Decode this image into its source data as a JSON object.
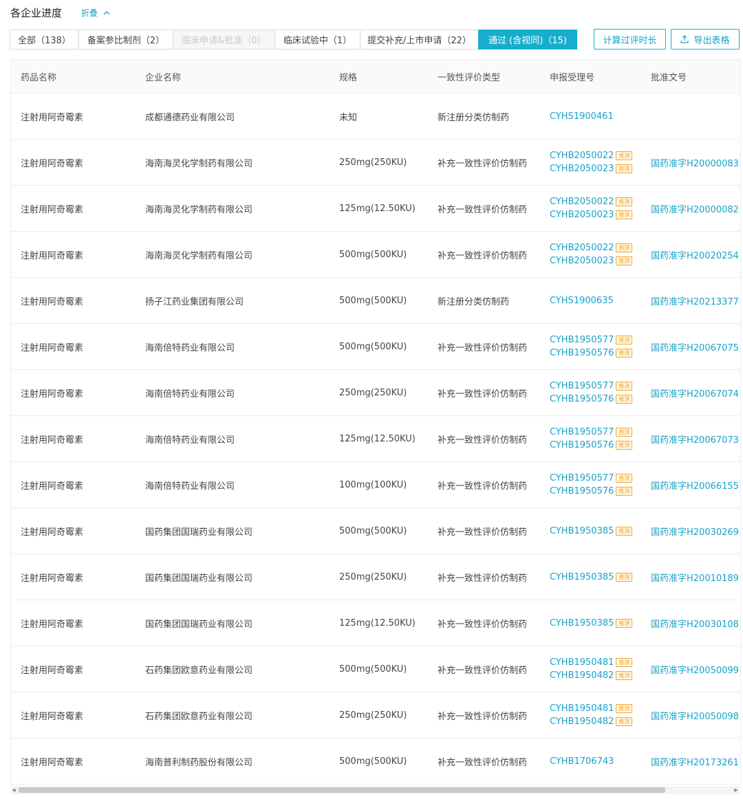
{
  "header": {
    "title": "各企业进度",
    "fold_label": "折叠",
    "fold_icon": "chevron-up"
  },
  "tabs": [
    {
      "label": "全部（138）",
      "state": "normal"
    },
    {
      "label": "备案参比制剂（2）",
      "state": "normal"
    },
    {
      "label": "临床申请&批准（0）",
      "state": "disabled"
    },
    {
      "label": "临床试验中（1）",
      "state": "normal"
    },
    {
      "label": "提交补充/上市申请（22）",
      "state": "normal"
    },
    {
      "label": "通过 (含视同)（15)",
      "state": "active"
    }
  ],
  "actions": {
    "calc_label": "计算过评时长",
    "export_label": "导出表格"
  },
  "colors": {
    "accent": "#17aece",
    "badge": "#f5a623"
  },
  "table": {
    "columns": [
      "药品名称",
      "企业名称",
      "规格",
      "一致性评价类型",
      "申报受理号",
      "批准文号"
    ],
    "badge_label": "推测",
    "rows": [
      {
        "drug": "注射用阿奇霉素",
        "company": "成都通德药业有限公司",
        "spec": "未知",
        "type": "新注册分类仿制药",
        "accept": [
          "CYHS1900461"
        ],
        "badge": [
          false
        ],
        "approval": ""
      },
      {
        "drug": "注射用阿奇霉素",
        "company": "海南海灵化学制药有限公司",
        "spec": "250mg(250KU)",
        "type": "补充一致性评价仿制药",
        "accept": [
          "CYHB2050022",
          "CYHB2050023"
        ],
        "badge": [
          true,
          true
        ],
        "approval": "国药准字H20000083"
      },
      {
        "drug": "注射用阿奇霉素",
        "company": "海南海灵化学制药有限公司",
        "spec": "125mg(12.50KU)",
        "type": "补充一致性评价仿制药",
        "accept": [
          "CYHB2050022",
          "CYHB2050023"
        ],
        "badge": [
          true,
          true
        ],
        "approval": "国药准字H20000082"
      },
      {
        "drug": "注射用阿奇霉素",
        "company": "海南海灵化学制药有限公司",
        "spec": "500mg(500KU)",
        "type": "补充一致性评价仿制药",
        "accept": [
          "CYHB2050022",
          "CYHB2050023"
        ],
        "badge": [
          true,
          true
        ],
        "approval": "国药准字H20020254"
      },
      {
        "drug": "注射用阿奇霉素",
        "company": "扬子江药业集团有限公司",
        "spec": "500mg(500KU)",
        "type": "新注册分类仿制药",
        "accept": [
          "CYHS1900635"
        ],
        "badge": [
          false
        ],
        "approval": "国药准字H20213377"
      },
      {
        "drug": "注射用阿奇霉素",
        "company": "海南倍特药业有限公司",
        "spec": "500mg(500KU)",
        "type": "补充一致性评价仿制药",
        "accept": [
          "CYHB1950577",
          "CYHB1950576"
        ],
        "badge": [
          true,
          true
        ],
        "approval": "国药准字H20067075"
      },
      {
        "drug": "注射用阿奇霉素",
        "company": "海南倍特药业有限公司",
        "spec": "250mg(250KU)",
        "type": "补充一致性评价仿制药",
        "accept": [
          "CYHB1950577",
          "CYHB1950576"
        ],
        "badge": [
          true,
          true
        ],
        "approval": "国药准字H20067074"
      },
      {
        "drug": "注射用阿奇霉素",
        "company": "海南倍特药业有限公司",
        "spec": "125mg(12.50KU)",
        "type": "补充一致性评价仿制药",
        "accept": [
          "CYHB1950577",
          "CYHB1950576"
        ],
        "badge": [
          true,
          true
        ],
        "approval": "国药准字H20067073"
      },
      {
        "drug": "注射用阿奇霉素",
        "company": "海南倍特药业有限公司",
        "spec": "100mg(100KU)",
        "type": "补充一致性评价仿制药",
        "accept": [
          "CYHB1950577",
          "CYHB1950576"
        ],
        "badge": [
          true,
          true
        ],
        "approval": "国药准字H20066155"
      },
      {
        "drug": "注射用阿奇霉素",
        "company": "国药集团国瑞药业有限公司",
        "spec": "500mg(500KU)",
        "type": "补充一致性评价仿制药",
        "accept": [
          "CYHB1950385"
        ],
        "badge": [
          true
        ],
        "approval": "国药准字H20030269"
      },
      {
        "drug": "注射用阿奇霉素",
        "company": "国药集团国瑞药业有限公司",
        "spec": "250mg(250KU)",
        "type": "补充一致性评价仿制药",
        "accept": [
          "CYHB1950385"
        ],
        "badge": [
          true
        ],
        "approval": "国药准字H20010189"
      },
      {
        "drug": "注射用阿奇霉素",
        "company": "国药集团国瑞药业有限公司",
        "spec": "125mg(12.50KU)",
        "type": "补充一致性评价仿制药",
        "accept": [
          "CYHB1950385"
        ],
        "badge": [
          true
        ],
        "approval": "国药准字H20030108"
      },
      {
        "drug": "注射用阿奇霉素",
        "company": "石药集团欧意药业有限公司",
        "spec": "500mg(500KU)",
        "type": "补充一致性评价仿制药",
        "accept": [
          "CYHB1950481",
          "CYHB1950482"
        ],
        "badge": [
          true,
          true
        ],
        "approval": "国药准字H20050099"
      },
      {
        "drug": "注射用阿奇霉素",
        "company": "石药集团欧意药业有限公司",
        "spec": "250mg(250KU)",
        "type": "补充一致性评价仿制药",
        "accept": [
          "CYHB1950481",
          "CYHB1950482"
        ],
        "badge": [
          true,
          true
        ],
        "approval": "国药准字H20050098"
      },
      {
        "drug": "注射用阿奇霉素",
        "company": "海南普利制药股份有限公司",
        "spec": "500mg(500KU)",
        "type": "补充一致性评价仿制药",
        "accept": [
          "CYHB1706743"
        ],
        "badge": [
          false
        ],
        "approval": "国药准字H20173261"
      }
    ]
  }
}
